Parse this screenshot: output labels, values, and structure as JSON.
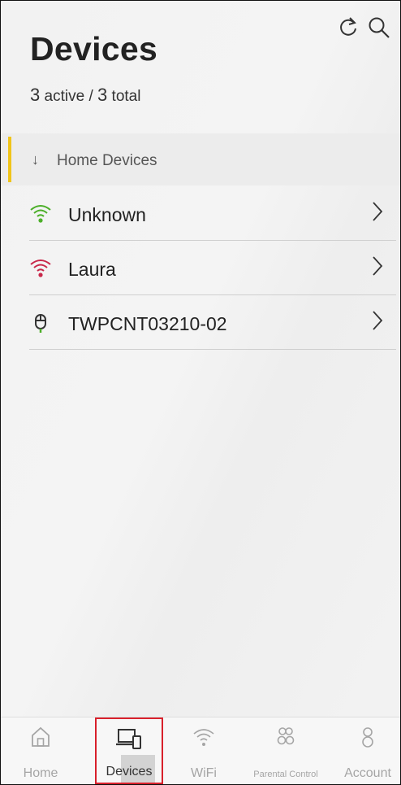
{
  "header": {
    "title": "Devices",
    "active_count": "3",
    "active_label": "active /",
    "total_count": "3",
    "total_label": "total"
  },
  "toolbar": {
    "refresh_icon": "refresh-icon",
    "search_icon": "search-icon"
  },
  "section": {
    "arrow": "↓",
    "label": "Home Devices",
    "accent_color": "#f0c419"
  },
  "devices": [
    {
      "name": "Unknown",
      "icon": "wifi-icon",
      "status_color": "#4caf29"
    },
    {
      "name": "Laura",
      "icon": "wifi-icon",
      "status_color": "#c8284a"
    },
    {
      "name": "TWPCNT03210-02",
      "icon": "mouse-icon",
      "status_color": "#4caf29"
    }
  ],
  "bottom_nav": {
    "items": [
      {
        "label": "Home",
        "icon": "home-icon"
      },
      {
        "label": "Devices",
        "icon": "devices-icon",
        "active": true
      },
      {
        "label": "WiFi",
        "icon": "wifi-icon"
      },
      {
        "label": "Parental Control",
        "icon": "parental-control-icon"
      },
      {
        "label": "Account",
        "icon": "account-icon"
      }
    ],
    "active_color": "#d8202b"
  }
}
